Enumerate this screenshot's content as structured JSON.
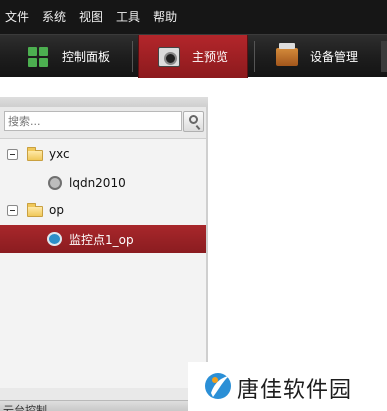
{
  "menubar": {
    "items": [
      "文件",
      "系统",
      "视图",
      "工具",
      "帮助"
    ]
  },
  "toolbar": {
    "tabs": [
      {
        "label": "控制面板",
        "icon": "control-panel-icon"
      },
      {
        "label": "主预览",
        "icon": "camera-preview-icon",
        "active": true
      },
      {
        "label": "设备管理",
        "icon": "device-manager-icon"
      }
    ]
  },
  "left_panel": {
    "search": {
      "placeholder": "搜索..."
    },
    "tree": [
      {
        "label": "yxc",
        "type": "group",
        "expanded": true
      },
      {
        "label": "lqdn2010",
        "type": "device"
      },
      {
        "label": "op",
        "type": "group",
        "expanded": true
      },
      {
        "label": "监控点1_op",
        "type": "camera",
        "selected": true
      }
    ],
    "footer_label": "云台控制"
  },
  "watermark": {
    "text": "唐佳软件园"
  },
  "colors": {
    "menubar_bg": "#161616",
    "toolbar_bg": "#1e1e1e",
    "active_tab": "#a8272b",
    "selected_row": "#9a2125",
    "panel_bg": "#e9e9e9",
    "watermark_blue": "#2b8fd6"
  }
}
